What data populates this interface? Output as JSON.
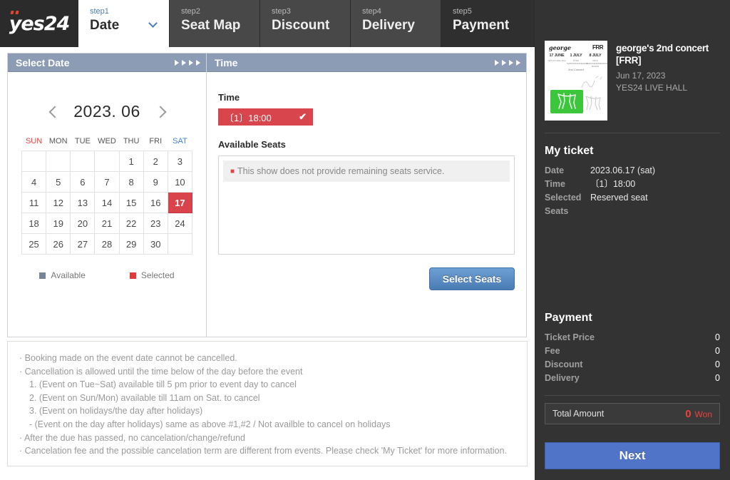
{
  "brand": {
    "logo_text": "yes24"
  },
  "steps": [
    {
      "num": "step1",
      "name": "Date"
    },
    {
      "num": "step2",
      "name": "Seat Map"
    },
    {
      "num": "step3",
      "name": "Discount"
    },
    {
      "num": "step4",
      "name": "Delivery"
    },
    {
      "num": "step5",
      "name": "Payment"
    }
  ],
  "date_panel": {
    "header": "Select Date",
    "year_month": "2023. 06",
    "weekdays": [
      "SUN",
      "MON",
      "TUE",
      "WED",
      "THU",
      "FRI",
      "SAT"
    ],
    "weeks": [
      [
        "",
        "",
        "",
        "",
        "1",
        "2",
        "3"
      ],
      [
        "4",
        "5",
        "6",
        "7",
        "8",
        "9",
        "10"
      ],
      [
        "11",
        "12",
        "13",
        "14",
        "15",
        "16",
        "17"
      ],
      [
        "18",
        "19",
        "20",
        "21",
        "22",
        "23",
        "24"
      ],
      [
        "25",
        "26",
        "27",
        "28",
        "29",
        "30",
        ""
      ]
    ],
    "selected_day": "17",
    "legend": [
      {
        "label": "Available",
        "color": "#778599"
      },
      {
        "label": "Selected",
        "color": "#dd3b3b"
      }
    ]
  },
  "time_panel": {
    "header": "Time",
    "time_label": "Time",
    "time_option": "〔1〕18:00",
    "time_check": "✔",
    "seats_label": "Available Seats",
    "seats_message": "This show does not provide remaining seats service.",
    "select_seats_button": "Select Seats"
  },
  "notice": [
    {
      "text": "Booking made on the event date cannot be cancelled.",
      "style": "dot"
    },
    {
      "text": "Cancellation is allowed until the time below of the day before the event",
      "style": "dot"
    },
    {
      "text": "1.  (Event on Tue~Sat) available till 5 pm prior to event day to cancel",
      "style": "ind1"
    },
    {
      "text": "2.  (Event on Sun/Mon) available till 11am on Sat. to cancel",
      "style": "ind1"
    },
    {
      "text": "3.  (Event on holidays/the day after holidays)",
      "style": "ind1"
    },
    {
      "text": "-  (Event on the day after holidays) same as above #1,#2 / Not availble to cancel on holidays",
      "style": "ind2"
    },
    {
      "text": "After the due has passed, no cancelation/change/refund",
      "style": "dot"
    },
    {
      "text": "Cancelation fee and the possible cancelation term are different from events. Please check 'My Ticket' for more information.",
      "style": "dot"
    }
  ],
  "sidebar": {
    "poster": {
      "brand": "george",
      "label": "FRR",
      "columns": [
        {
          "date": "17 JUNE",
          "venue": "YES 24 LIVE HALL"
        },
        {
          "date": "1 JULY",
          "venue": "KT&G SANGSANGMADANG"
        },
        {
          "date": "8 JULY",
          "venue": "MUJI SANGSANGMADANG BUSAN"
        }
      ],
      "subtitle": "2nd Concert"
    },
    "event_title": "george's 2nd concert [FRR]",
    "event_date": "Jun 17, 2023",
    "event_venue": "YES24 LIVE HALL",
    "my_ticket": {
      "title": "My ticket",
      "rows": [
        {
          "key": "Date",
          "value": "2023.06.17 (sat)"
        },
        {
          "key": "Time",
          "value": "〔1〕18:00"
        },
        {
          "key": "Selected Seats",
          "value": "Reserved seat"
        }
      ]
    },
    "payment": {
      "title": "Payment",
      "rows": [
        {
          "key": "Ticket Price",
          "value": "0"
        },
        {
          "key": "Fee",
          "value": "0"
        },
        {
          "key": "Discount",
          "value": "0"
        },
        {
          "key": "Delivery",
          "value": "0"
        }
      ],
      "total_label": "Total Amount",
      "total_value": "0",
      "currency": "Won"
    },
    "next_button": "Next"
  }
}
